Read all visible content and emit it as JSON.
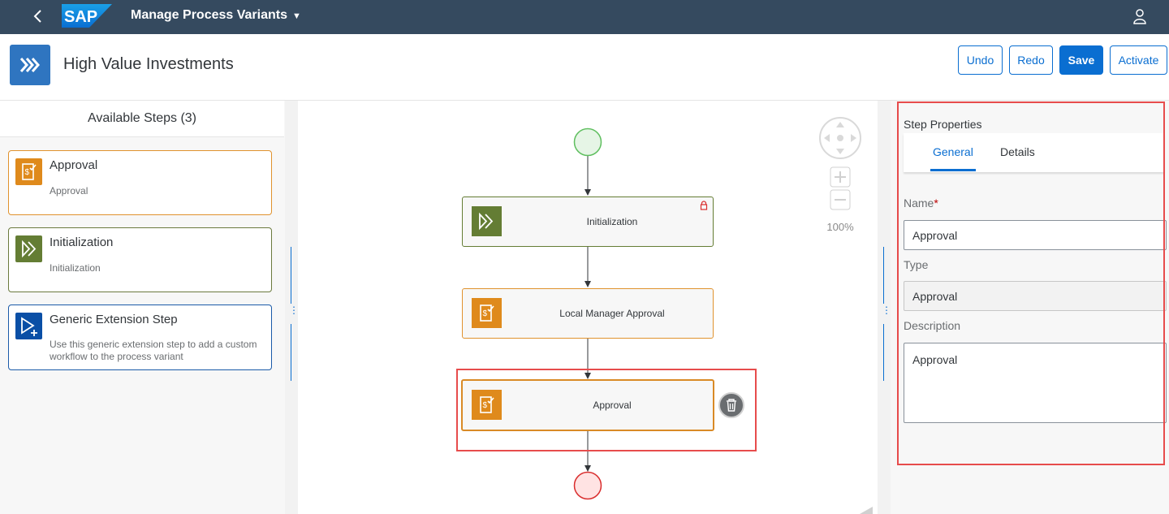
{
  "shell": {
    "logo_text": "SAP",
    "app_title": "Manage Process Variants",
    "icons": {
      "back": "chevron-left-icon",
      "menu": "caret-down-icon",
      "user": "user-icon"
    }
  },
  "header": {
    "title": "High Value Investments",
    "icon": "process-forward-icon",
    "buttons": {
      "undo": "Undo",
      "redo": "Redo",
      "save": "Save",
      "activate": "Activate"
    }
  },
  "available_steps": {
    "heading": "Available Steps (3)",
    "items": [
      {
        "title": "Approval",
        "subtitle": "Approval",
        "icon": "approval-icon",
        "color": "#df8a1c"
      },
      {
        "title": "Initialization",
        "subtitle": "Initialization",
        "icon": "initialization-icon",
        "color": "#647d34"
      },
      {
        "title": "Generic Extension Step",
        "subtitle": "Use this generic extension step to add a custom workflow to the process variant",
        "icon": "extension-step-icon",
        "color": "#0a4fa6"
      }
    ]
  },
  "canvas": {
    "zoom": "100%",
    "nodes": [
      {
        "label": "Initialization",
        "locked": true,
        "color": "#647d34"
      },
      {
        "label": "Local Manager Approval",
        "locked": false,
        "color": "#df8a1c"
      },
      {
        "label": "Approval",
        "locked": false,
        "selected": true,
        "color": "#df8a1c"
      }
    ]
  },
  "properties": {
    "heading": "Step Properties",
    "tabs": [
      {
        "label": "General",
        "active": true
      },
      {
        "label": "Details",
        "active": false
      }
    ],
    "name_label": "Name",
    "required_mark": "*",
    "name_value": "Approval",
    "type_label": "Type",
    "type_value": "Approval",
    "description_label": "Description",
    "description_value": "Approval"
  },
  "colors": {
    "shell": "#354a5f",
    "accent": "#0a6ed1",
    "approval": "#df8a1c",
    "initialization": "#647d34",
    "start_node": "#e6f5e6",
    "end_node": "#ffe3e3",
    "highlight": "#e74c4c"
  }
}
